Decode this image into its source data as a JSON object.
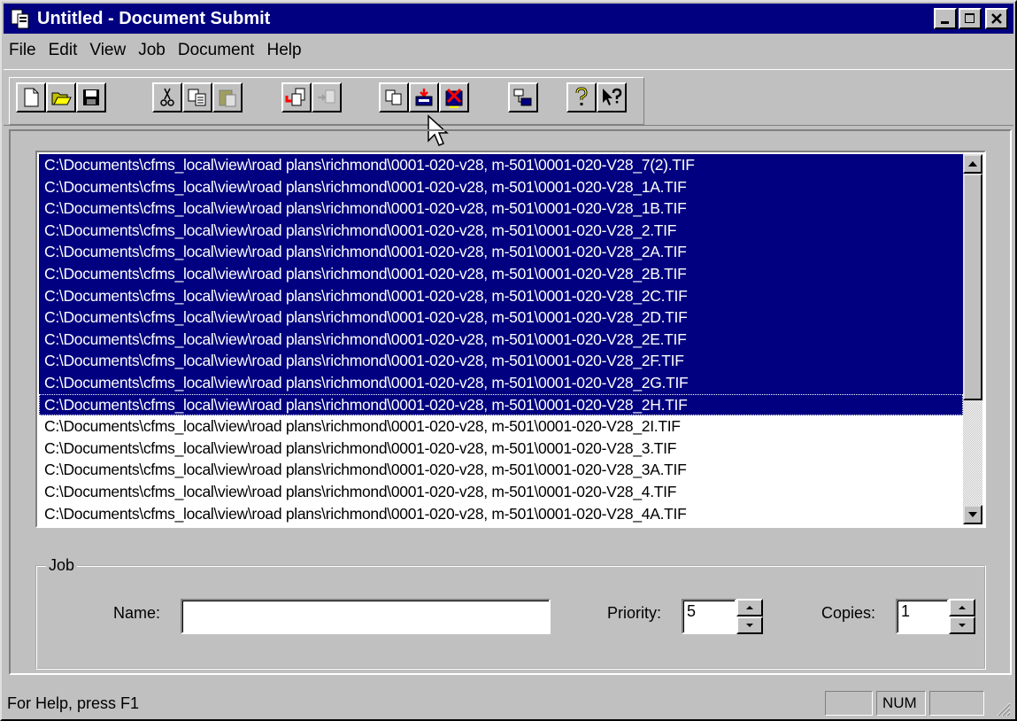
{
  "window": {
    "title": "Untitled - Document Submit"
  },
  "menu": [
    {
      "label": "File"
    },
    {
      "label": "Edit"
    },
    {
      "label": "View"
    },
    {
      "label": "Job"
    },
    {
      "label": "Document"
    },
    {
      "label": "Help"
    }
  ],
  "toolbar": {
    "buttons": [
      "new-icon",
      "open-icon",
      "save-icon",
      "cut-icon",
      "copy-icon",
      "paste-icon",
      "add-document-icon",
      "remove-document-icon",
      "duplicate-icon",
      "submit-icon",
      "clear-icon",
      "properties-icon",
      "help-icon",
      "context-help-icon"
    ]
  },
  "list": {
    "items": [
      {
        "text": "C:\\Documents\\cfms_local\\view\\road plans\\richmond\\0001-020-v28, m-501\\0001-020-V28_7(2).TIF",
        "selected": true
      },
      {
        "text": "C:\\Documents\\cfms_local\\view\\road plans\\richmond\\0001-020-v28, m-501\\0001-020-V28_1A.TIF",
        "selected": true
      },
      {
        "text": "C:\\Documents\\cfms_local\\view\\road plans\\richmond\\0001-020-v28, m-501\\0001-020-V28_1B.TIF",
        "selected": true
      },
      {
        "text": "C:\\Documents\\cfms_local\\view\\road plans\\richmond\\0001-020-v28, m-501\\0001-020-V28_2.TIF",
        "selected": true
      },
      {
        "text": "C:\\Documents\\cfms_local\\view\\road plans\\richmond\\0001-020-v28, m-501\\0001-020-V28_2A.TIF",
        "selected": true
      },
      {
        "text": "C:\\Documents\\cfms_local\\view\\road plans\\richmond\\0001-020-v28, m-501\\0001-020-V28_2B.TIF",
        "selected": true
      },
      {
        "text": "C:\\Documents\\cfms_local\\view\\road plans\\richmond\\0001-020-v28, m-501\\0001-020-V28_2C.TIF",
        "selected": true
      },
      {
        "text": "C:\\Documents\\cfms_local\\view\\road plans\\richmond\\0001-020-v28, m-501\\0001-020-V28_2D.TIF",
        "selected": true
      },
      {
        "text": "C:\\Documents\\cfms_local\\view\\road plans\\richmond\\0001-020-v28, m-501\\0001-020-V28_2E.TIF",
        "selected": true
      },
      {
        "text": "C:\\Documents\\cfms_local\\view\\road plans\\richmond\\0001-020-v28, m-501\\0001-020-V28_2F.TIF",
        "selected": true
      },
      {
        "text": "C:\\Documents\\cfms_local\\view\\road plans\\richmond\\0001-020-v28, m-501\\0001-020-V28_2G.TIF",
        "selected": true
      },
      {
        "text": "C:\\Documents\\cfms_local\\view\\road plans\\richmond\\0001-020-v28, m-501\\0001-020-V28_2H.TIF",
        "selected": true,
        "focused": true
      },
      {
        "text": "C:\\Documents\\cfms_local\\view\\road plans\\richmond\\0001-020-v28, m-501\\0001-020-V28_2I.TIF",
        "selected": false
      },
      {
        "text": "C:\\Documents\\cfms_local\\view\\road plans\\richmond\\0001-020-v28, m-501\\0001-020-V28_3.TIF",
        "selected": false
      },
      {
        "text": "C:\\Documents\\cfms_local\\view\\road plans\\richmond\\0001-020-v28, m-501\\0001-020-V28_3A.TIF",
        "selected": false
      },
      {
        "text": "C:\\Documents\\cfms_local\\view\\road plans\\richmond\\0001-020-v28, m-501\\0001-020-V28_4.TIF",
        "selected": false
      },
      {
        "text": "C:\\Documents\\cfms_local\\view\\road plans\\richmond\\0001-020-v28, m-501\\0001-020-V28_4A.TIF",
        "selected": false
      }
    ]
  },
  "job": {
    "group_label": "Job",
    "name_label": "Name:",
    "name_value": "",
    "priority_label": "Priority:",
    "priority_value": "5",
    "copies_label": "Copies:",
    "copies_value": "1"
  },
  "status": {
    "text": "For Help, press F1",
    "indicators": [
      "",
      "NUM",
      ""
    ]
  },
  "colors": {
    "selection": "#000080",
    "titlebar": "#000080",
    "face": "#c0c0c0"
  }
}
